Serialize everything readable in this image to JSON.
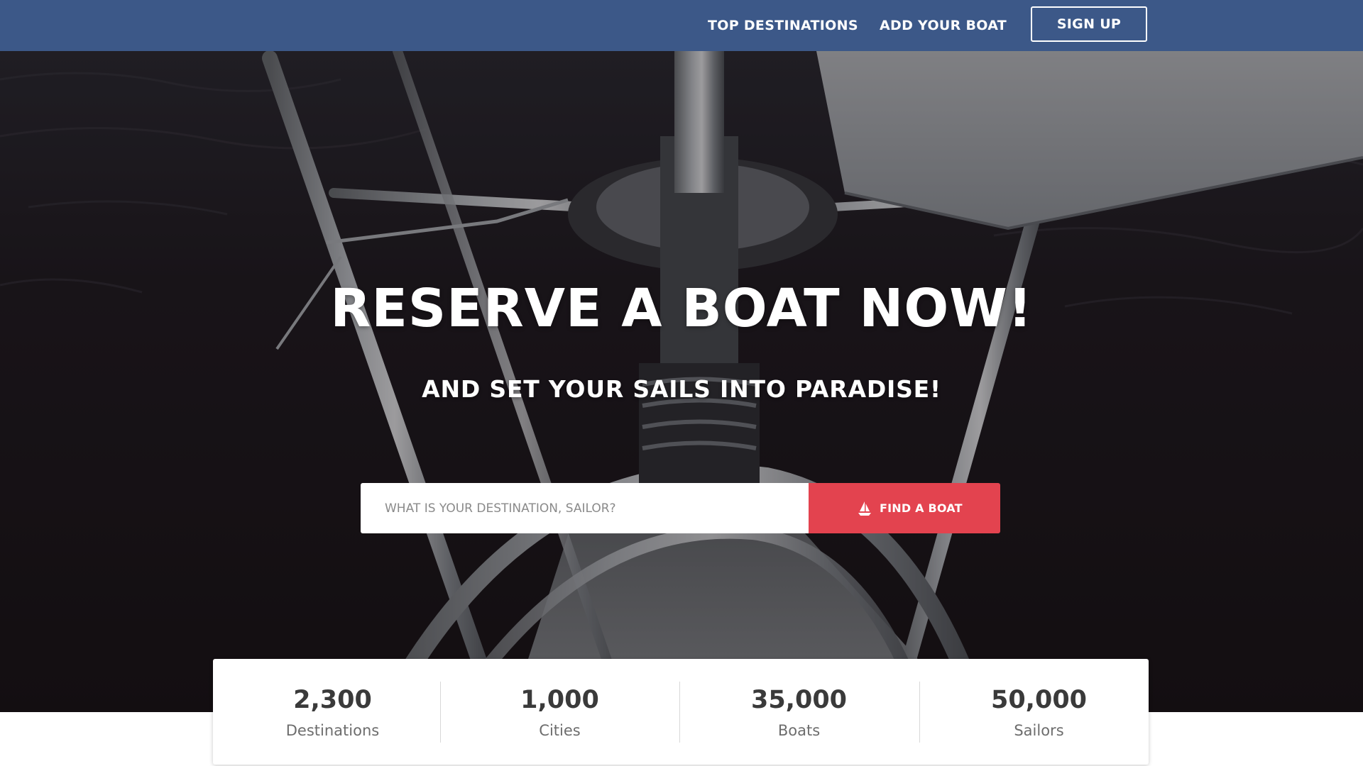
{
  "nav": {
    "top_destinations": "TOP DESTINATIONS",
    "add_your_boat": "ADD YOUR BOAT",
    "sign_up": "SIGN UP"
  },
  "hero": {
    "title": "RESERVE A BOAT NOW!",
    "subtitle": "AND SET YOUR SAILS INTO PARADISE!",
    "background_image": "sailboat-bow-on-dark-water"
  },
  "search": {
    "placeholder": "WHAT IS YOUR DESTINATION, SAILOR?",
    "value": "",
    "button_label": "FIND A BOAT",
    "button_icon": "sailboat-icon"
  },
  "stats": [
    {
      "value": "2,300",
      "label": "Destinations"
    },
    {
      "value": "1,000",
      "label": "Cities"
    },
    {
      "value": "35,000",
      "label": "Boats"
    },
    {
      "value": "50,000",
      "label": "Sailors"
    }
  ],
  "colors": {
    "nav_bg": "#3c5888",
    "accent": "#e3434f",
    "hero_bg": "#1a1416",
    "stat_value": "#3a3a3a",
    "stat_label": "#6d6d6d"
  }
}
